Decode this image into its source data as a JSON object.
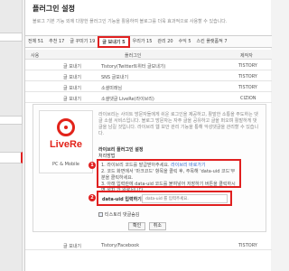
{
  "page": {
    "title": "플러그인 설정",
    "description": "블로그 기본 기능 외에 다양한 플러그인 기능을 활용하여 블로그를 더욱 효과적으로 사용할 수 있습니다."
  },
  "tabs": [
    {
      "label": "전체 51"
    },
    {
      "label": "추천 17"
    },
    {
      "label": "글 꾸미기 19"
    },
    {
      "label": "글 보내기 5",
      "active": true
    },
    {
      "label": "우리가 15"
    },
    {
      "label": "관리 20"
    },
    {
      "label": "수익 5"
    },
    {
      "label": "스킨 플랫폼적 7"
    }
  ],
  "table": {
    "headers": [
      "사용",
      "플러그인",
      "제작자"
    ],
    "rows": [
      {
        "type": "글 보내기",
        "name": "Tistory(Twitter트위터 글보내기)",
        "author": "TISTORY"
      },
      {
        "type": "글 보내기",
        "name": "SNS 글보내기",
        "author": "TISTORY"
      },
      {
        "type": "글 보내기",
        "name": "소셜미래님",
        "author": "TISTORY"
      },
      {
        "type": "글 보내기",
        "name": "소셜댓글 LiveRe(라이브리)",
        "author": "CIZION"
      }
    ],
    "last_row": {
      "type": "글 보내기",
      "name": "Tistory/Facebook",
      "author": "TISTORY"
    }
  },
  "plugin": {
    "logo_text": "LiveRe",
    "platform": "PC & Mobile",
    "description": "라이브리는 사이트 방문자들에게 쉬운 로그인을 제공하고, 활발한 소통을 주도하는 댓글 소셜 서비스입니다. 블로그 방문자는 자주 글을 공유하고 글을 퍼오며 활발하게 댓글을 남길 것입니다. 라이브리 웹 보안 관리 기능을 통해 악성댓글을 관리할 수 있습니다.",
    "settings_title": "라이브리 플러그인 설정",
    "settings_subtitle": "처리방법",
    "step1_text": "1. 라이브리 코드를 발급받아주세요.",
    "step1_link": "라이브리 바로가기",
    "step2_text": "2. 코드 화면에서 '마크코드' 항목을 클릭 후, 주목해 'data-uid 코드'부분을 클릭하세요.",
    "step3_text": "3. 아래 입력란에 data-uid 코드를 붙여넣어 저장하기 버튼을 클릭하시면 설치 가 완료됩니다.",
    "field_label": "data-uid 입력하기",
    "field_placeholder": "data-uid 를 입력주세요.",
    "checkbox_label": "티스토리 댓글숨김",
    "confirm_label": "확인",
    "cancel_label": "취소",
    "badge1": "1",
    "badge2": "2"
  }
}
